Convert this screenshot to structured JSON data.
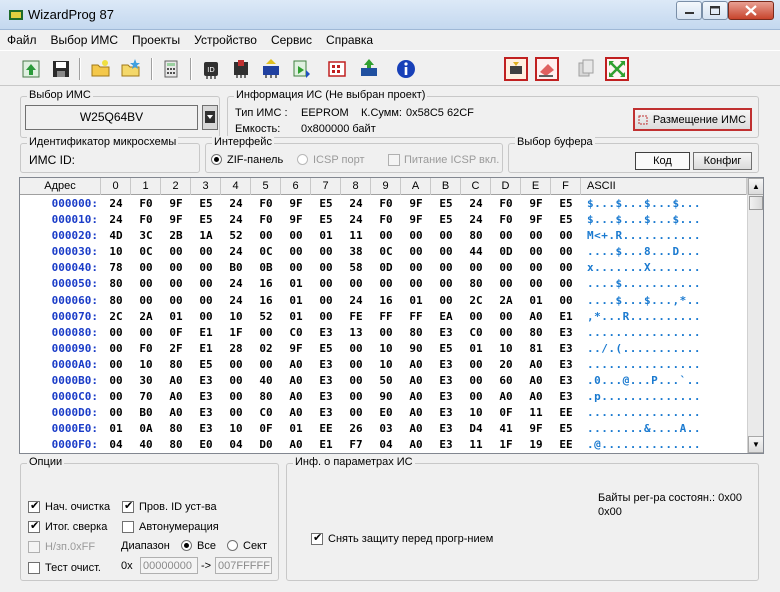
{
  "window": {
    "title": "WizardProg 87"
  },
  "menu": [
    "Файл",
    "Выбор ИМС",
    "Проекты",
    "Устройство",
    "Сервис",
    "Справка"
  ],
  "toolbar": {
    "icons": [
      "open-icon",
      "save-icon",
      "open-folder-icon",
      "folder-star-icon",
      "calculator-icon",
      "chip-id-icon",
      "chip-blank-icon",
      "chip-read-icon",
      "chip-program-icon",
      "chip-verify-icon",
      "chip-erase-icon",
      "info-icon",
      "chip-place-icon",
      "eraser-icon",
      "copy-disabled-icon",
      "fullscreen-icon"
    ]
  },
  "chip_select": {
    "label": "Выбор ИМС",
    "value": "W25Q64BV"
  },
  "chip_info": {
    "label": "Информация ИС (Не выбран проект)",
    "type_label": "Тип ИМС :",
    "type_value": "EEPROM",
    "checksum_label": "К.Сумм:",
    "checksum_value": "0x58C5 62CF",
    "capacity_label": "Емкость:",
    "capacity_value": "0x800000 байт",
    "placement_button": "Размещение ИМС"
  },
  "chip_id": {
    "label": "Идентификатор микросхемы",
    "field_label": "ИМС ID:"
  },
  "interface": {
    "label": "Интерфейс",
    "zif": "ZIF-панель",
    "icsp": "ICSP порт",
    "icsp_power": "Питание ICSP вкл."
  },
  "buffer": {
    "label": "Выбор буфера",
    "code": "Код",
    "config": "Конфиг"
  },
  "hex": {
    "headers": [
      "Адрес",
      "0",
      "1",
      "2",
      "3",
      "4",
      "5",
      "6",
      "7",
      "8",
      "9",
      "A",
      "B",
      "C",
      "D",
      "E",
      "F",
      "ASCII"
    ],
    "rows": [
      {
        "addr": "000000:",
        "bytes": [
          "24",
          "F0",
          "9F",
          "E5",
          "24",
          "F0",
          "9F",
          "E5",
          "24",
          "F0",
          "9F",
          "E5",
          "24",
          "F0",
          "9F",
          "E5"
        ],
        "ascii": "$...$...$...$..."
      },
      {
        "addr": "000010:",
        "bytes": [
          "24",
          "F0",
          "9F",
          "E5",
          "24",
          "F0",
          "9F",
          "E5",
          "24",
          "F0",
          "9F",
          "E5",
          "24",
          "F0",
          "9F",
          "E5"
        ],
        "ascii": "$...$...$...$..."
      },
      {
        "addr": "000020:",
        "bytes": [
          "4D",
          "3C",
          "2B",
          "1A",
          "52",
          "00",
          "00",
          "01",
          "11",
          "00",
          "00",
          "00",
          "80",
          "00",
          "00",
          "00"
        ],
        "ascii": "M<+.R..........."
      },
      {
        "addr": "000030:",
        "bytes": [
          "10",
          "0C",
          "00",
          "00",
          "24",
          "0C",
          "00",
          "00",
          "38",
          "0C",
          "00",
          "00",
          "44",
          "0D",
          "00",
          "00"
        ],
        "ascii": "....$...8...D..."
      },
      {
        "addr": "000040:",
        "bytes": [
          "78",
          "00",
          "00",
          "00",
          "B0",
          "0B",
          "00",
          "00",
          "58",
          "0D",
          "00",
          "00",
          "00",
          "00",
          "00",
          "00"
        ],
        "ascii": "x.......X......."
      },
      {
        "addr": "000050:",
        "bytes": [
          "80",
          "00",
          "00",
          "00",
          "24",
          "16",
          "01",
          "00",
          "00",
          "00",
          "00",
          "00",
          "80",
          "00",
          "00",
          "00"
        ],
        "ascii": "....$..........."
      },
      {
        "addr": "000060:",
        "bytes": [
          "80",
          "00",
          "00",
          "00",
          "24",
          "16",
          "01",
          "00",
          "24",
          "16",
          "01",
          "00",
          "2C",
          "2A",
          "01",
          "00"
        ],
        "ascii": "....$...$...,*.."
      },
      {
        "addr": "000070:",
        "bytes": [
          "2C",
          "2A",
          "01",
          "00",
          "10",
          "52",
          "01",
          "00",
          "FE",
          "FF",
          "FF",
          "EA",
          "00",
          "00",
          "A0",
          "E1"
        ],
        "ascii": ",*...R.........."
      },
      {
        "addr": "000080:",
        "bytes": [
          "00",
          "00",
          "0F",
          "E1",
          "1F",
          "00",
          "C0",
          "E3",
          "13",
          "00",
          "80",
          "E3",
          "C0",
          "00",
          "80",
          "E3"
        ],
        "ascii": "................"
      },
      {
        "addr": "000090:",
        "bytes": [
          "00",
          "F0",
          "2F",
          "E1",
          "28",
          "02",
          "9F",
          "E5",
          "00",
          "10",
          "90",
          "E5",
          "01",
          "10",
          "81",
          "E3"
        ],
        "ascii": "../.(..........."
      },
      {
        "addr": "0000A0:",
        "bytes": [
          "00",
          "10",
          "80",
          "E5",
          "00",
          "00",
          "A0",
          "E3",
          "00",
          "10",
          "A0",
          "E3",
          "00",
          "20",
          "A0",
          "E3"
        ],
        "ascii": "................"
      },
      {
        "addr": "0000B0:",
        "bytes": [
          "00",
          "30",
          "A0",
          "E3",
          "00",
          "40",
          "A0",
          "E3",
          "00",
          "50",
          "A0",
          "E3",
          "00",
          "60",
          "A0",
          "E3"
        ],
        "ascii": ".0...@...P...`.."
      },
      {
        "addr": "0000C0:",
        "bytes": [
          "00",
          "70",
          "A0",
          "E3",
          "00",
          "80",
          "A0",
          "E3",
          "00",
          "90",
          "A0",
          "E3",
          "00",
          "A0",
          "A0",
          "E3"
        ],
        "ascii": ".p.............."
      },
      {
        "addr": "0000D0:",
        "bytes": [
          "00",
          "B0",
          "A0",
          "E3",
          "00",
          "C0",
          "A0",
          "E3",
          "00",
          "E0",
          "A0",
          "E3",
          "10",
          "0F",
          "11",
          "EE"
        ],
        "ascii": "................"
      },
      {
        "addr": "0000E0:",
        "bytes": [
          "01",
          "0A",
          "80",
          "E3",
          "10",
          "0F",
          "01",
          "EE",
          "26",
          "03",
          "A0",
          "E3",
          "D4",
          "41",
          "9F",
          "E5"
        ],
        "ascii": "........&....A.."
      },
      {
        "addr": "0000F0:",
        "bytes": [
          "04",
          "40",
          "80",
          "E0",
          "04",
          "D0",
          "A0",
          "E1",
          "F7",
          "04",
          "A0",
          "E3",
          "11",
          "1F",
          "19",
          "EE"
        ],
        "ascii": ".@.............."
      }
    ]
  },
  "options": {
    "label": "Опции",
    "final_erase": "Нач. очистка",
    "check_id": "Пров. ID уст-ва",
    "final_verify": "Итог. сверка",
    "autonumber": "Автонумерация",
    "skip_ff": "Н/зп.0xFF",
    "range_label": "Диапазон",
    "range_all": "Все",
    "range_sector": "Сект",
    "test_clean": "Тест очист.",
    "prefix": "0x",
    "range_from": "00000000",
    "arrow": "->",
    "range_to": "007FFFFF"
  },
  "params": {
    "label": "Инф. о параметрах ИС",
    "status_regs": "Байты рег-ра состоян.: 0x00",
    "status_regs2": "0x00",
    "remove_protection": "Снять защиту перед прогр-нием"
  },
  "colors": {
    "address": "#1a3cc8",
    "ascii": "#1a7ad0",
    "accent_red": "#cc2020"
  }
}
